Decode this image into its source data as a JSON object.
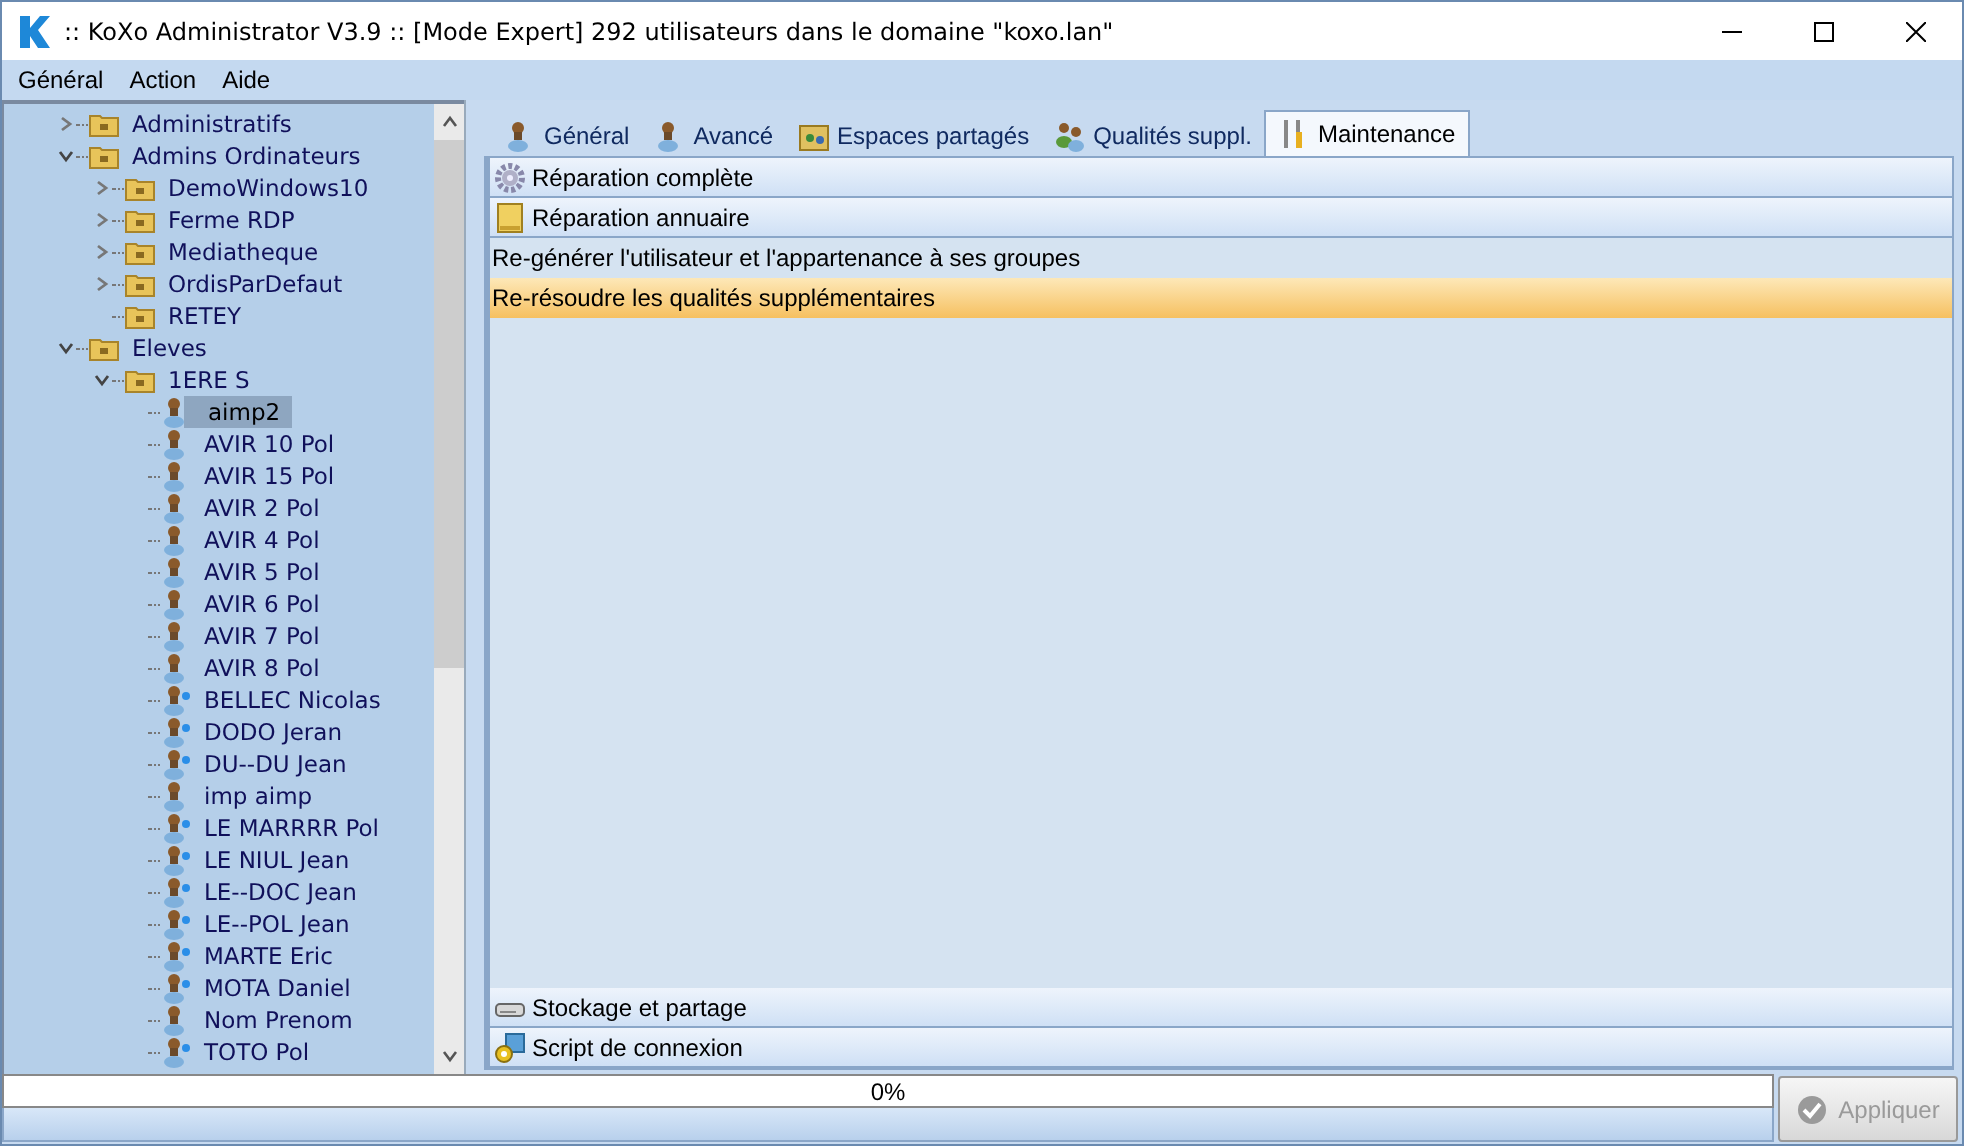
{
  "window": {
    "title": ":: KoXo Administrator V3.9 :: [Mode Expert] 292 utilisateurs dans le domaine \"koxo.lan\""
  },
  "menu": [
    "Général",
    "Action",
    "Aide"
  ],
  "tree": [
    {
      "label": "Administratifs",
      "kind": "folder",
      "expanded": false,
      "selected": false
    },
    {
      "label": "Admins Ordinateurs",
      "kind": "folder",
      "expanded": true,
      "selected": false,
      "children": [
        {
          "label": "DemoWindows10",
          "kind": "folder",
          "expanded": false,
          "selected": false
        },
        {
          "label": "Ferme RDP",
          "kind": "folder",
          "expanded": false,
          "selected": false
        },
        {
          "label": "Mediatheque",
          "kind": "folder",
          "expanded": false,
          "selected": false
        },
        {
          "label": "OrdisParDefaut",
          "kind": "folder",
          "expanded": false,
          "selected": false
        },
        {
          "label": "RETEY",
          "kind": "folder",
          "selected": false
        }
      ]
    },
    {
      "label": "Eleves",
      "kind": "folder",
      "expanded": true,
      "selected": false,
      "children": [
        {
          "label": "1ERE S",
          "kind": "folder",
          "expanded": true,
          "selected": false,
          "children": [
            {
              "label": "aimp2",
              "kind": "user",
              "flagged": false,
              "selected": true
            },
            {
              "label": "AVIR 10 Pol",
              "kind": "user",
              "flagged": false,
              "selected": false
            },
            {
              "label": "AVIR 15 Pol",
              "kind": "user",
              "flagged": false,
              "selected": false
            },
            {
              "label": "AVIR 2 Pol",
              "kind": "user",
              "flagged": false,
              "selected": false
            },
            {
              "label": "AVIR 4 Pol",
              "kind": "user",
              "flagged": false,
              "selected": false
            },
            {
              "label": "AVIR 5 Pol",
              "kind": "user",
              "flagged": false,
              "selected": false
            },
            {
              "label": "AVIR 6 Pol",
              "kind": "user",
              "flagged": false,
              "selected": false
            },
            {
              "label": "AVIR 7 Pol",
              "kind": "user",
              "flagged": false,
              "selected": false
            },
            {
              "label": "AVIR 8 Pol",
              "kind": "user",
              "flagged": false,
              "selected": false
            },
            {
              "label": "BELLEC Nicolas",
              "kind": "user",
              "flagged": true,
              "selected": false
            },
            {
              "label": "DODO Jeran",
              "kind": "user",
              "flagged": true,
              "selected": false
            },
            {
              "label": "DU--DU Jean",
              "kind": "user",
              "flagged": true,
              "selected": false
            },
            {
              "label": "imp aimp",
              "kind": "user",
              "flagged": false,
              "selected": false
            },
            {
              "label": "LE MARRRR Pol",
              "kind": "user",
              "flagged": true,
              "selected": false
            },
            {
              "label": "LE NIUL Jean",
              "kind": "user",
              "flagged": true,
              "selected": false
            },
            {
              "label": "LE--DOC Jean",
              "kind": "user",
              "flagged": true,
              "selected": false
            },
            {
              "label": "LE--POL Jean",
              "kind": "user",
              "flagged": true,
              "selected": false
            },
            {
              "label": "MARTE Eric",
              "kind": "user",
              "flagged": true,
              "selected": false
            },
            {
              "label": "MOTA Daniel",
              "kind": "user",
              "flagged": true,
              "selected": false
            },
            {
              "label": "Nom Prenom",
              "kind": "user",
              "flagged": false,
              "selected": false
            },
            {
              "label": "TOTO Pol",
              "kind": "user",
              "flagged": true,
              "selected": false
            }
          ]
        }
      ]
    }
  ],
  "tabs": [
    {
      "label": "Général",
      "kind": "user",
      "selected": false
    },
    {
      "label": "Avancé",
      "kind": "user",
      "selected": false
    },
    {
      "label": "Espaces partagés",
      "kind": "share",
      "selected": false
    },
    {
      "label": "Qualités suppl.",
      "kind": "group",
      "selected": false
    },
    {
      "label": "Maintenance",
      "kind": "tools",
      "selected": true
    }
  ],
  "sections": [
    {
      "title": "Réparation complète",
      "kind": "gear"
    },
    {
      "title": "Réparation annuaire",
      "kind": "book",
      "items": [
        {
          "label": "Re-générer l'utilisateur et l'appartenance à ses groupes",
          "selected": false
        },
        {
          "label": "Re-résoudre les qualités supplémentaires",
          "selected": true
        }
      ]
    },
    {
      "title": "Stockage et partage",
      "kind": "disk"
    },
    {
      "title": "Script de connexion",
      "kind": "script"
    }
  ],
  "progress": {
    "level": 0,
    "reading": "0%"
  },
  "apply_button": {
    "label": "Appliquer",
    "disabled": true
  }
}
